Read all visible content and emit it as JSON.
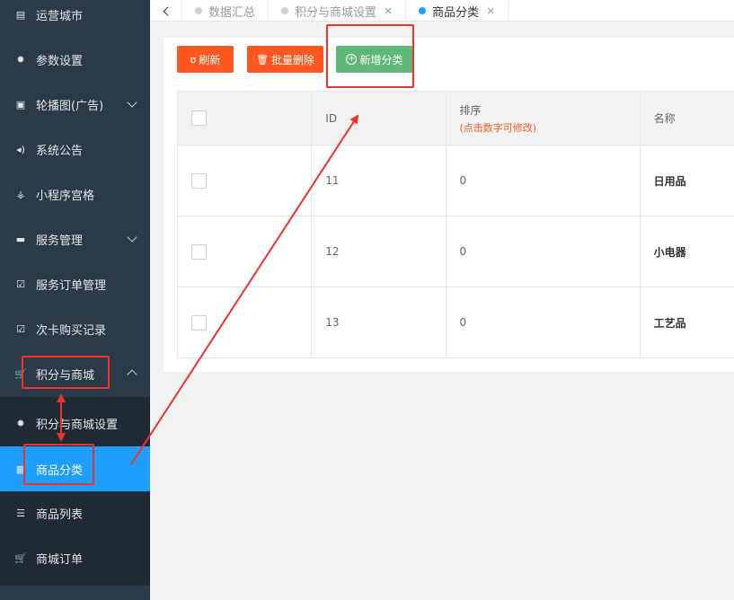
{
  "sidebar": {
    "items": [
      {
        "label": "运营城市",
        "icon": "building-icon"
      },
      {
        "label": "参数设置",
        "icon": "gear-icon"
      },
      {
        "label": "轮播图(广告)",
        "icon": "image-icon"
      },
      {
        "label": "系统公告",
        "icon": "speaker-icon"
      },
      {
        "label": "小程序宫格",
        "icon": "sitemap-icon"
      },
      {
        "label": "服务管理",
        "icon": "list-icon"
      },
      {
        "label": "服务订单管理",
        "icon": "checkbox-icon"
      },
      {
        "label": "次卡购买记录",
        "icon": "checkbox-icon"
      },
      {
        "label": "积分与商城",
        "icon": "cart-icon"
      }
    ],
    "submenu": [
      {
        "label": "积分与商城设置",
        "icon": "gear-icon"
      },
      {
        "label": "商品分类",
        "icon": "grid-icon"
      },
      {
        "label": "商品列表",
        "icon": "sliders-icon"
      },
      {
        "label": "商城订单",
        "icon": "cart-icon"
      }
    ]
  },
  "tabs": [
    {
      "label": "数据汇总"
    },
    {
      "label": "积分与商城设置",
      "close": "×"
    },
    {
      "label": "商品分类",
      "close": "×"
    }
  ],
  "toolbar": {
    "refresh_label": "刷新",
    "refresh_icon": "ʊ",
    "batch_delete_label": "批量删除",
    "batch_delete_icon": "🗑",
    "add_category_label": "新增分类",
    "add_category_icon": "+"
  },
  "table": {
    "headers": {
      "id": "ID",
      "sort": "排序",
      "sort_hint": "(点击数字可修改)",
      "name": "名称"
    },
    "rows": [
      {
        "id": "11",
        "sort": "0",
        "name": "日用品"
      },
      {
        "id": "12",
        "sort": "0",
        "name": "小电器"
      },
      {
        "id": "13",
        "sort": "0",
        "name": "工艺品"
      }
    ]
  },
  "colors": {
    "accent": "#1e9fff",
    "danger": "#ff5722",
    "success": "#5fb878",
    "annotation": "#f0322a"
  }
}
